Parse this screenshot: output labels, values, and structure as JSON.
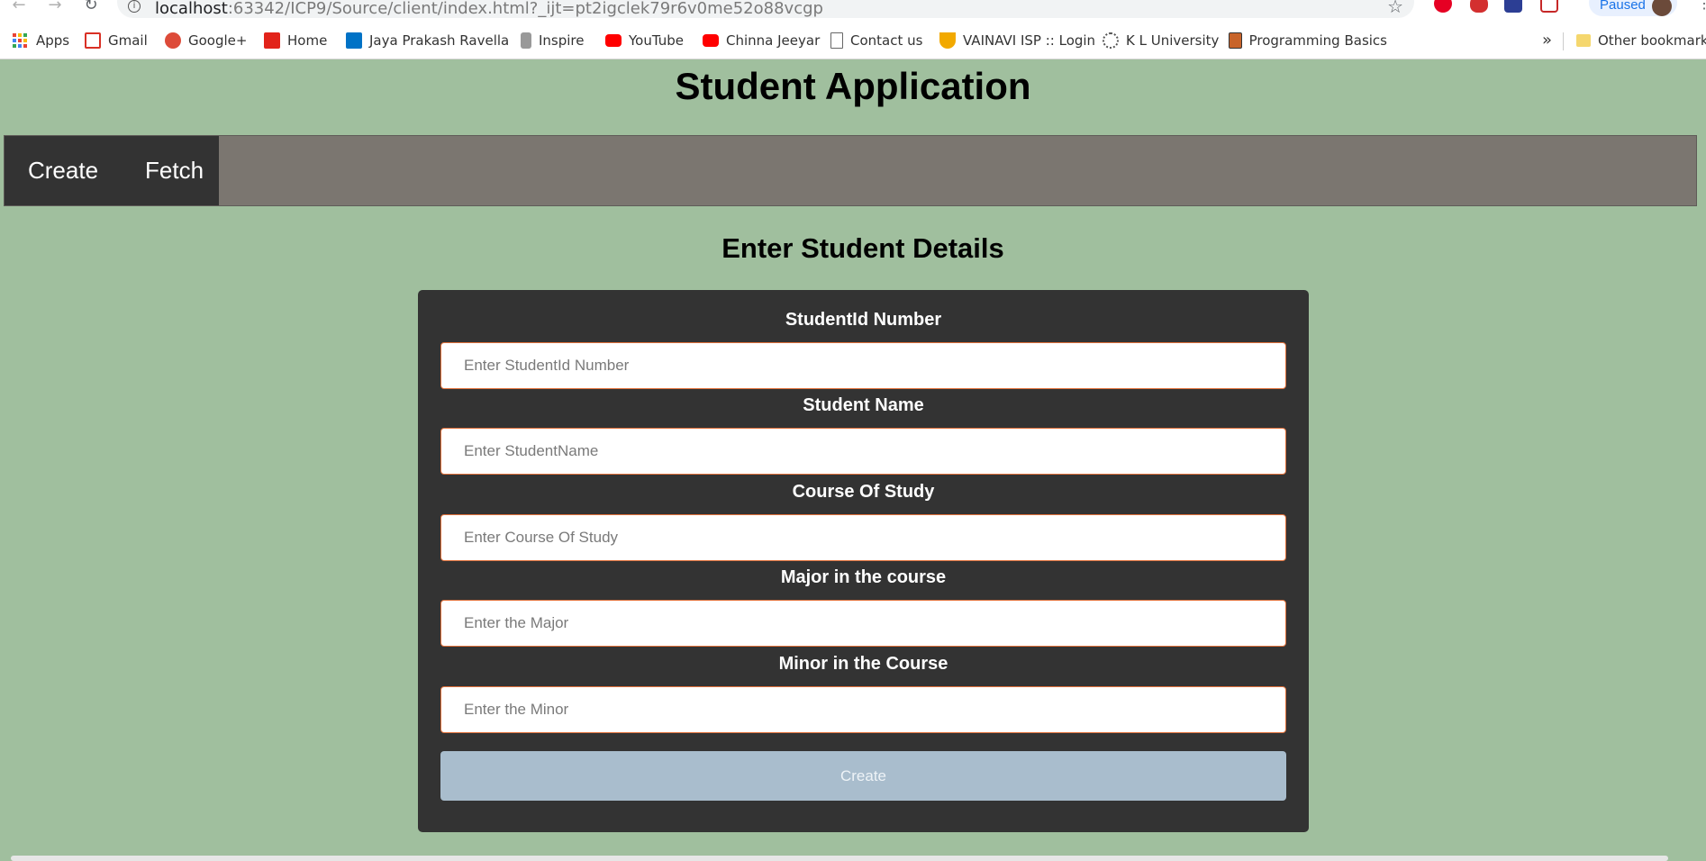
{
  "browser": {
    "url_host": "localhost",
    "url_path": ":63342/ICP9/Source/client/index.html?_ijt=pt2igclek79r6v0me52o88vcgp",
    "profile_status": "Paused",
    "bookmarks": [
      {
        "label": "Apps",
        "icon": "apps-grid-icon"
      },
      {
        "label": "Gmail",
        "icon": "gmail-icon",
        "color": "#d93025"
      },
      {
        "label": "Google+",
        "icon": "google-plus-icon",
        "color": "#dd4b39"
      },
      {
        "label": "Home",
        "icon": "act-icon",
        "color": "#e2231a"
      },
      {
        "label": "Jaya Prakash Ravella",
        "icon": "outlook-icon",
        "color": "#0072c6"
      },
      {
        "label": "Inspire",
        "icon": "emblem-icon",
        "color": "#888888"
      },
      {
        "label": "YouTube",
        "icon": "youtube-icon",
        "color": "#ff0000"
      },
      {
        "label": "Chinna Jeeyar",
        "icon": "youtube-icon",
        "color": "#ff0000"
      },
      {
        "label": "Contact us",
        "icon": "page-icon",
        "color": "#ffffff"
      },
      {
        "label": "VAINAVI ISP :: Login",
        "icon": "shield-logo-icon",
        "color": "#f2a900"
      },
      {
        "label": "K L University",
        "icon": "gear-logo-icon",
        "color": "#555555"
      },
      {
        "label": "Programming Basics",
        "icon": "book-icon",
        "color": "#c8642a"
      }
    ],
    "other_bookmarks": "Other bookmarks",
    "overflow": "»"
  },
  "page": {
    "title": "Student Application",
    "nav": [
      {
        "label": "Create"
      },
      {
        "label": "Fetch"
      }
    ],
    "section_title": "Enter Student Details",
    "form": {
      "fields": [
        {
          "label": "StudentId Number",
          "placeholder": "Enter StudentId Number",
          "value": ""
        },
        {
          "label": "Student Name",
          "placeholder": "Enter StudentName",
          "value": ""
        },
        {
          "label": "Course Of Study",
          "placeholder": "Enter Course Of Study",
          "value": ""
        },
        {
          "label": "Major in the course",
          "placeholder": "Enter the Major",
          "value": ""
        },
        {
          "label": "Minor in the Course",
          "placeholder": "Enter the Minor",
          "value": ""
        }
      ],
      "submit_label": "Create"
    }
  },
  "colors": {
    "page_bg": "#a0bf9e",
    "navbar_bg": "#7b7670",
    "nav_links_bg": "#333333",
    "card_bg": "#333333",
    "input_border": "#e0703a",
    "button_bg": "#a9bdcd"
  }
}
